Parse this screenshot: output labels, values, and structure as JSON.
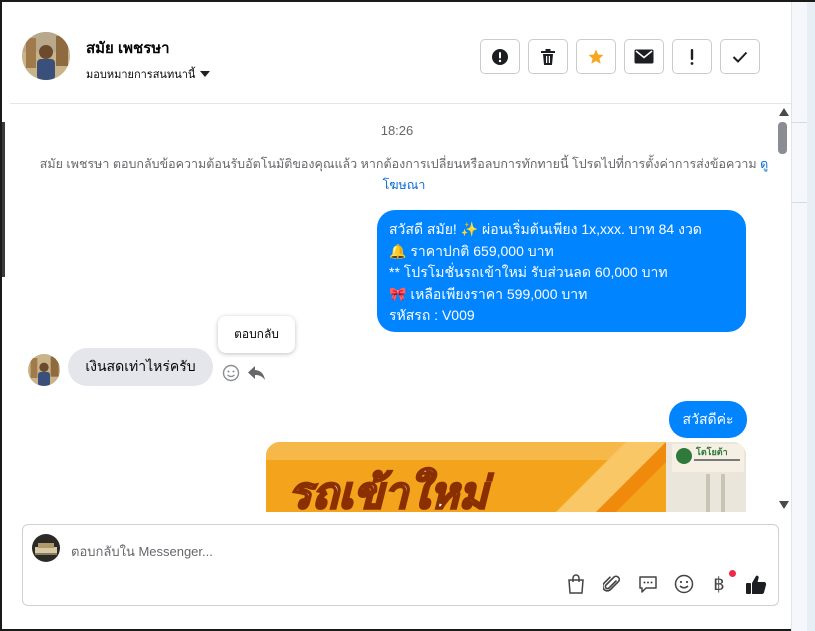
{
  "header": {
    "contact_name": "สมัย เพชรษา",
    "assign_label": "มอบหมายการสนทนานี้",
    "buttons": [
      {
        "name": "alert-circle-button",
        "icon": "alert-circle-icon"
      },
      {
        "name": "delete-button",
        "icon": "trash-icon"
      },
      {
        "name": "star-button",
        "icon": "star-icon",
        "color": "#f5a623"
      },
      {
        "name": "mail-button",
        "icon": "envelope-icon"
      },
      {
        "name": "mark-important-button",
        "icon": "exclamation-icon"
      },
      {
        "name": "mark-done-button",
        "icon": "check-icon"
      }
    ]
  },
  "conversation": {
    "timestamp": "18:26",
    "notice_text": "สมัย เพชรษา ตอบกลับข้อความต้อนรับอัตโนมัติของคุณแล้ว หากต้องการเปลี่ยนหรือลบการทักทายนี้ โปรดไปที่การตั้งค่าการส่งข้อความ",
    "notice_link": "ดูโฆษณา",
    "outgoing_message_lines": [
      "สวัสดี สมัย! ✨  ผ่อนเริ่มต้นเพียง 1x,xxx. บาท 84 งวด",
      "🔔 ราคาปกติ 659,000 บาท",
      "** โปรโมชั่นรถเข้าใหม่ รับส่วนลด 60,000 บาท",
      "🎀  เหลือเพียงราคา 599,000 บาท",
      " รหัสรถ : V009"
    ],
    "reply_tooltip": "ตอบกลับ",
    "incoming_message": "เงินสดเท่าไหร่ครับ",
    "outgoing_greeting": "สวัสดีค่ะ",
    "image_banner_text": "รถเข้าใหม่",
    "image_logo_text": "โตโยต้า"
  },
  "composer": {
    "placeholder": "ตอบกลับใน Messenger...",
    "baht_symbol": "฿",
    "icons": [
      "shopping-bag-icon",
      "paperclip-icon",
      "saved-replies-icon",
      "emoji-icon",
      "baht-icon",
      "thumbs-up-icon"
    ]
  },
  "colors": {
    "accent": "#0084ff",
    "star": "#f5a623",
    "incoming_bubble": "#e4e6eb",
    "notification_dot": "#f02849"
  }
}
